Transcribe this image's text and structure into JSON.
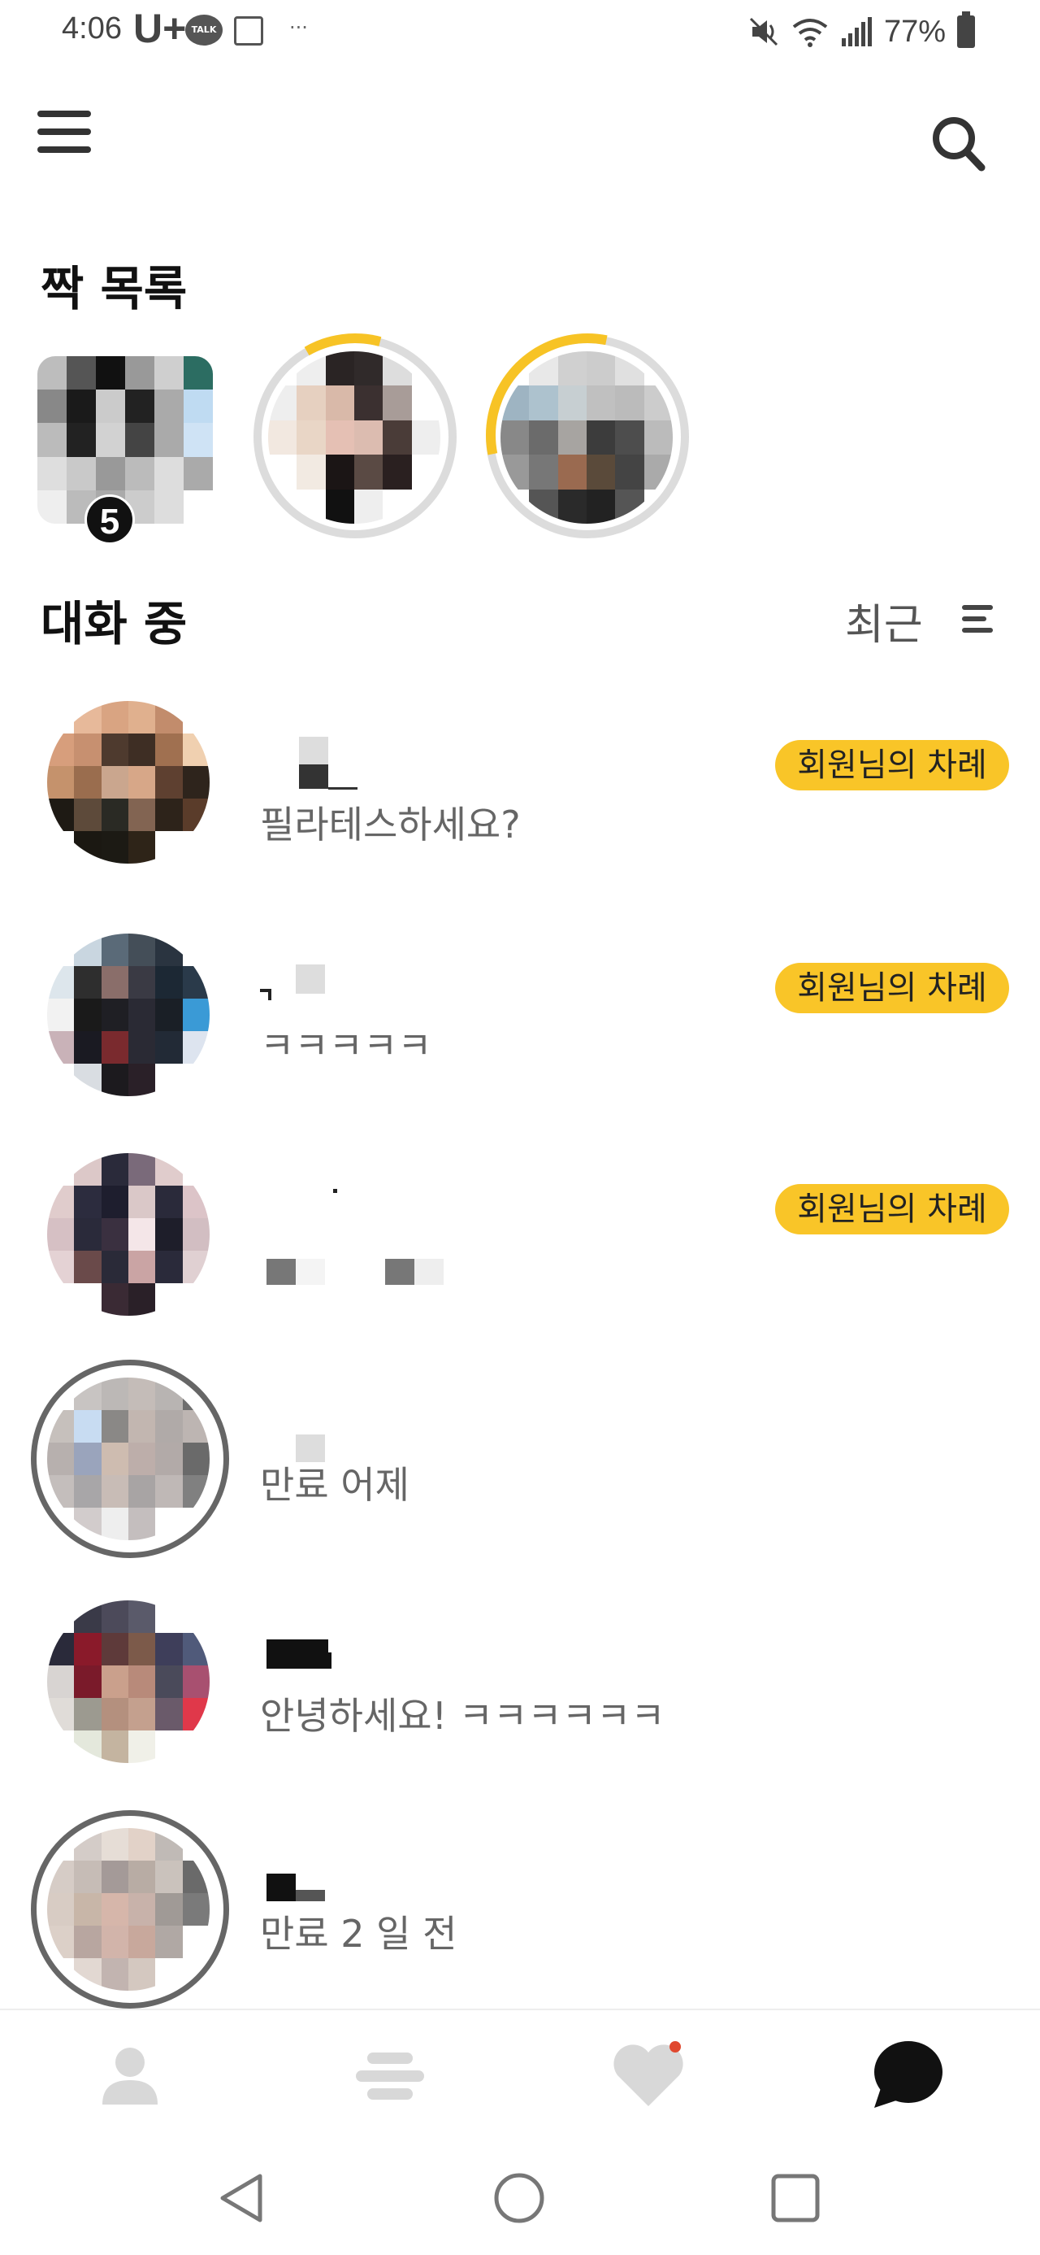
{
  "status_bar": {
    "time": "4:06",
    "carrier": "U+",
    "talk_badge": "TALK",
    "overflow": "···",
    "battery": "77%",
    "icons": [
      "mute-icon",
      "wifi-icon",
      "signal-icon",
      "battery-icon"
    ]
  },
  "header": {
    "menu_icon": "hamburger-menu-icon",
    "search_icon": "search-icon"
  },
  "matches": {
    "title": "짝 목록",
    "first_card_badge": "5"
  },
  "conversations": {
    "title": "대화 중",
    "sort_label": "최근",
    "sort_icon": "sort-lines-icon",
    "items": [
      {
        "message": "필라테스하세요?",
        "badge": "회원님의 차례"
      },
      {
        "message": "ㅋㅋㅋㅋㅋ",
        "badge": "회원님의 차례"
      },
      {
        "message": "",
        "badge": "회원님의 차례"
      },
      {
        "message": "만료 어제",
        "badge": ""
      },
      {
        "message": "안녕하세요! ㅋㅋㅋㅋㅋㅋ",
        "badge": ""
      },
      {
        "message": "만료 2 일 전",
        "badge": ""
      }
    ]
  },
  "bottom_nav": {
    "items": [
      "profile-icon",
      "feed-icon",
      "heart-icon",
      "chat-bubble-icon"
    ],
    "active": "chat-bubble-icon"
  },
  "system_nav": [
    "back-icon",
    "home-icon",
    "recent-apps-icon"
  ],
  "colors": {
    "accent": "#f9c528",
    "notification": "#e0482f"
  }
}
